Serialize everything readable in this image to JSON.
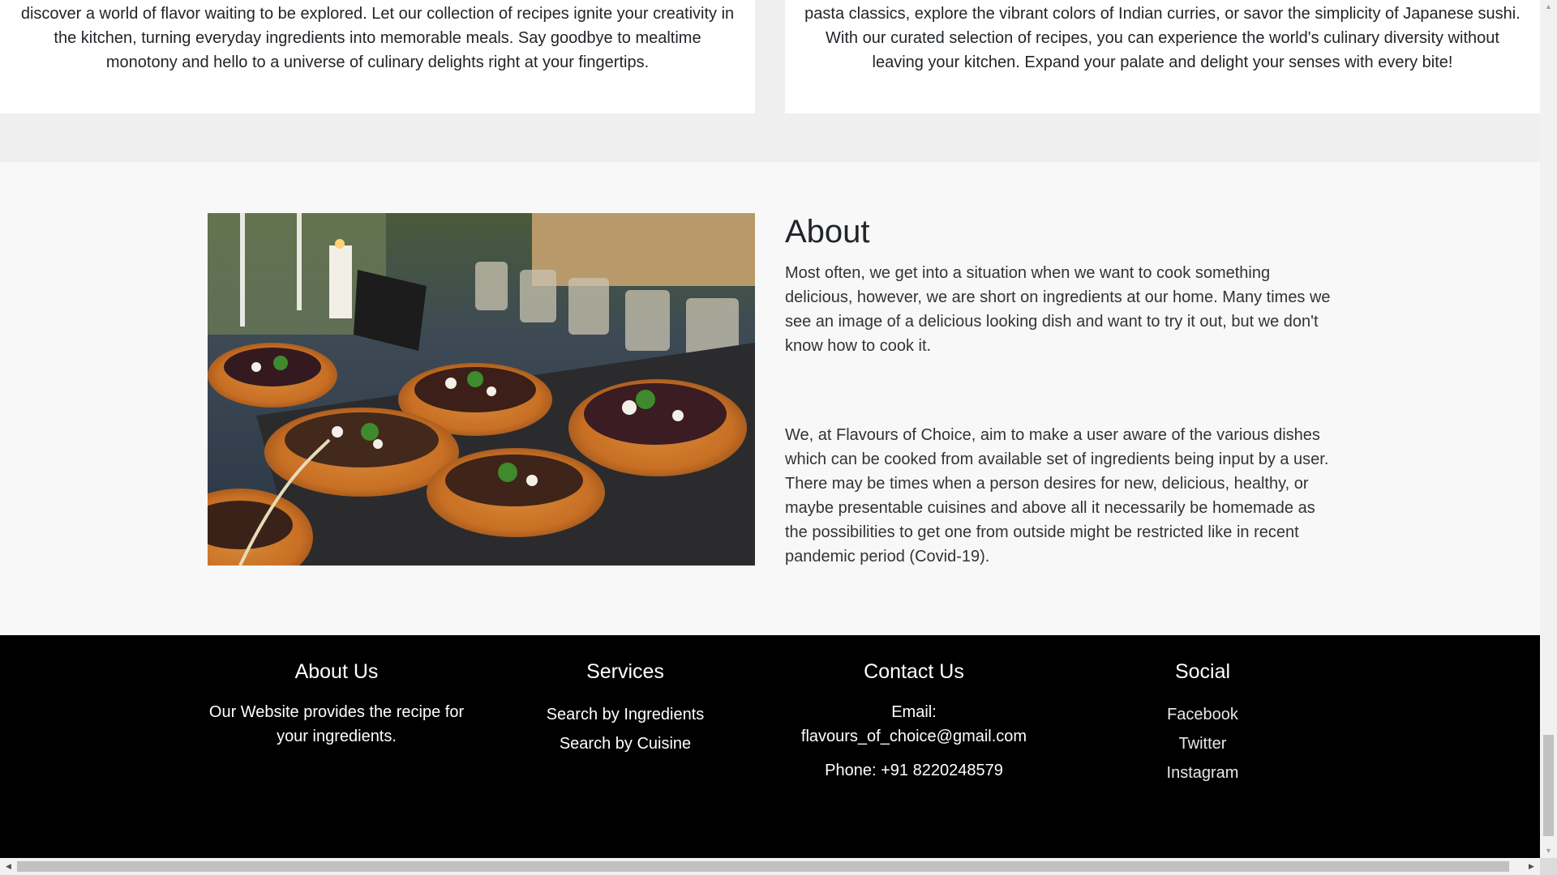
{
  "cards": {
    "left_text": "discover a world of flavor waiting to be explored. Let our collection of recipes ignite your creativity in the kitchen, turning everyday ingredients into memorable meals. Say goodbye to mealtime monotony and hello to a universe of culinary delights right at your fingertips.",
    "right_text": "pasta classics, explore the vibrant colors of Indian curries, or savor the simplicity of Japanese sushi. With our curated selection of recipes, you can experience the world's culinary diversity without leaving your kitchen. Expand your palate and delight your senses with every bite!"
  },
  "about": {
    "title": "About",
    "para1": "Most often, we get into a situation when we want to cook something delicious, however, we are short on ingredients at our home. Many times we see an image of a delicious looking dish and want to try it out, but we don't know how to cook it.",
    "para2": "We, at Flavours of Choice, aim to make a user aware of the various dishes which can be cooked from available set of ingredients being input by a user. There may be times when a person desires for new, delicious, healthy, or maybe presentable cuisines and above all it necessarily be homemade as the possibilities to get one from outside might be restricted like in recent pandemic period (Covid-19)."
  },
  "footer": {
    "about_us": {
      "title": "About Us",
      "text": "Our Website provides the recipe for your ingredients."
    },
    "services": {
      "title": "Services",
      "links": [
        "Search by Ingredients",
        "Search by Cuisine"
      ]
    },
    "contact": {
      "title": "Contact Us",
      "email_label": "Email:",
      "email": "flavours_of_choice@gmail.com",
      "phone": "Phone: +91 8220248579"
    },
    "social": {
      "title": "Social",
      "links": [
        "Facebook",
        "Twitter",
        "Instagram"
      ]
    }
  },
  "colors": {
    "footer_bg": "#000000",
    "section_bg": "#f8f8f8",
    "page_bg": "#efefef"
  }
}
